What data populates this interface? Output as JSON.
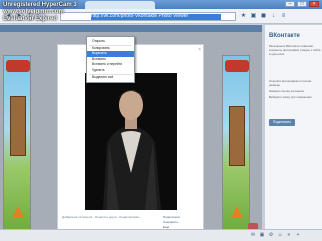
{
  "watermark": "Unregistered HyperCam 3 www.solveigmm.com Evaluation Expired",
  "browser": {
    "nav": {
      "back": "◄",
      "forward": "►",
      "reload": "↻",
      "home": "⌂"
    },
    "url_selected": "http://vk.com/photo-Vkontakte Photo Viewer",
    "ext_icons": [
      "star-icon",
      "vk-icon",
      "save-icon",
      "download-icon",
      "menu-icon"
    ],
    "window_buttons": [
      "–",
      "□",
      "×"
    ]
  },
  "context_menu": {
    "items": [
      {
        "label": "Открыть"
      },
      {
        "label": "Копировать"
      },
      {
        "label": "Вырезать"
      },
      {
        "label": "Вставить"
      },
      {
        "label": "Вставить и перейти"
      },
      {
        "label": "Удалить"
      },
      {
        "label": "Выделить всё"
      }
    ],
    "active_index": 2
  },
  "sidebar": {
    "title": "ВКонтакте",
    "description": "Расширение ВКонтакте позволяет сохранять фотографии и видео с сайта в один клик.",
    "list": [
      "Откройте фотографию в полном размере",
      "Нажмите кнопку на панели",
      "Выберите папку для сохранения"
    ],
    "button": "Подключить"
  },
  "photo_meta": "Добавлена 12 апреля · Отметить друга · Редактировать",
  "photo_side": [
    "Поделиться",
    "Сохранить",
    "Ещё"
  ],
  "photo_close": "×"
}
